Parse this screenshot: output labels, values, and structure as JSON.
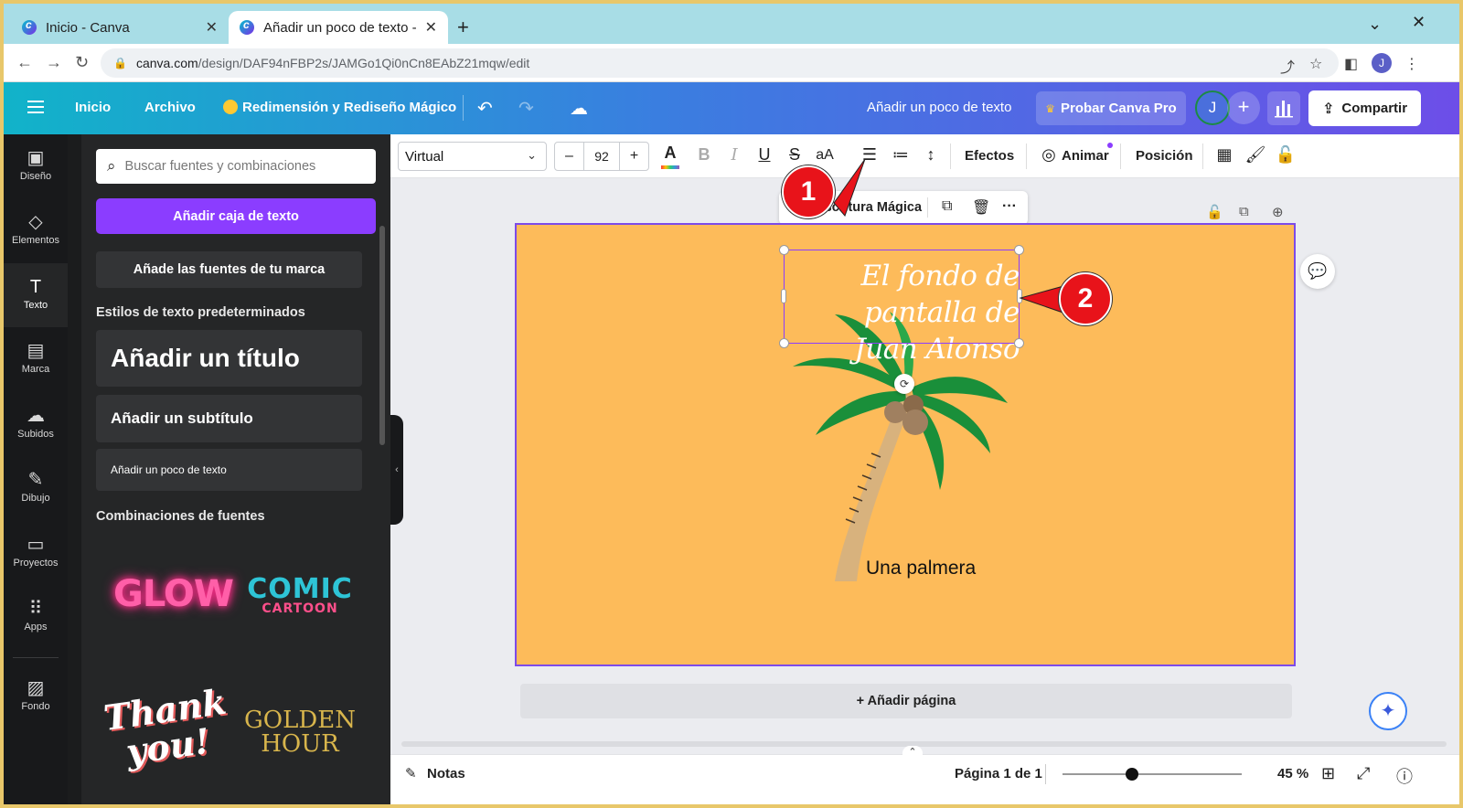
{
  "browser": {
    "tabs": [
      {
        "label": "Inicio - Canva",
        "active": false
      },
      {
        "label": "Añadir un poco de texto - ",
        "active": true
      }
    ],
    "url_host": "canva.com",
    "url_path": "/design/DAF94nFBP2s/JAMGo1Qi0nCn8EAbZ21mqw/edit",
    "account_initial": "J"
  },
  "header": {
    "inicio": "Inicio",
    "archivo": "Archivo",
    "magic": "Redimensión y Rediseño Mágico",
    "doc_title": "Añadir un poco de texto",
    "pro": "Probar Canva Pro",
    "avatar": "J",
    "share": "Compartir"
  },
  "rail": [
    {
      "label": "Diseño",
      "icon": "layout-icon"
    },
    {
      "label": "Elementos",
      "icon": "shapes-icon"
    },
    {
      "label": "Texto",
      "icon": "text-icon",
      "active": true
    },
    {
      "label": "Marca",
      "icon": "brand-icon"
    },
    {
      "label": "Subidos",
      "icon": "upload-icon"
    },
    {
      "label": "Dibujo",
      "icon": "draw-icon"
    },
    {
      "label": "Proyectos",
      "icon": "folder-icon"
    },
    {
      "label": "Apps",
      "icon": "apps-icon"
    },
    {
      "label": "Fondo",
      "icon": "background-icon"
    }
  ],
  "panel": {
    "search_placeholder": "Buscar fuentes y combinaciones",
    "add_textbox": "Añadir caja de texto",
    "brand_fonts": "Añade las fuentes de tu marca",
    "default_styles_title": "Estilos de texto predeterminados",
    "add_title": "Añadir un título",
    "add_subtitle": "Añadir un subtítulo",
    "add_body": "Añadir un poco de texto",
    "combos_title": "Combinaciones de fuentes",
    "combos": {
      "glow": "GLOW",
      "comic": "COMIC",
      "cartoon": "CARTOON",
      "thank": "Thank you!",
      "golden": "GOLDEN HOUR"
    }
  },
  "toolbar": {
    "font": "Virtual",
    "minus": "–",
    "size": "92",
    "plus": "+",
    "case": "aA",
    "effects": "Efectos",
    "animate": "Animar",
    "position": "Posición"
  },
  "context_bar": {
    "label": "Escritura Mágica"
  },
  "canvas": {
    "heading_text": "El fondo de pantalla de\nJuan Alonso",
    "caption": "Una palmera",
    "background": "#fdbb5a"
  },
  "add_page": "+ Añadir página",
  "footer": {
    "notes": "Notas",
    "page_info": "Página 1 de 1",
    "zoom": "45 %",
    "zoom_fraction": 0.45
  },
  "callouts": [
    "1",
    "2"
  ],
  "colors": {
    "accent": "#8b3dff",
    "callout": "#e8131a"
  }
}
